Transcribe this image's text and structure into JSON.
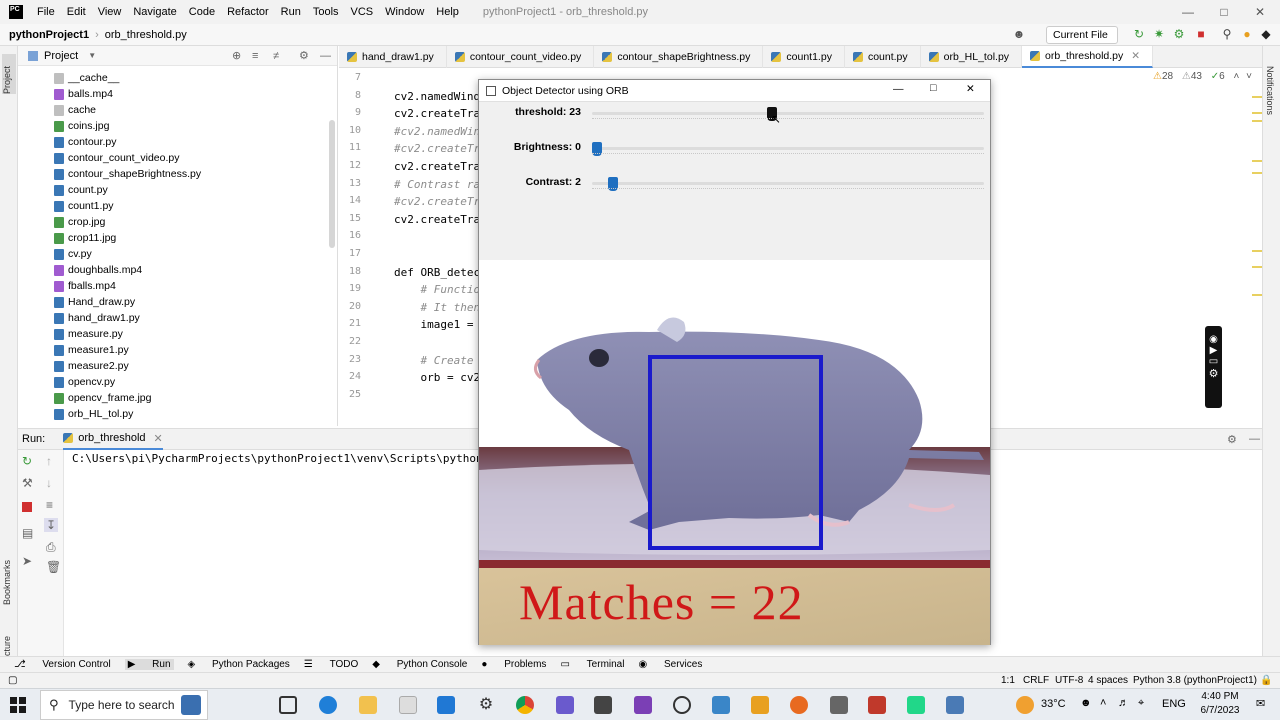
{
  "menu": {
    "items": [
      "File",
      "Edit",
      "View",
      "Navigate",
      "Code",
      "Refactor",
      "Run",
      "Tools",
      "VCS",
      "Window",
      "Help"
    ],
    "window_title": "pythonProject1 - orb_threshold.py"
  },
  "navbar": {
    "project": "pythonProject1",
    "file": "orb_threshold.py",
    "run_config": "Current File"
  },
  "project_panel": {
    "title": "Project",
    "strip_label": "Project",
    "files": [
      "__cache__",
      "balls.mp4",
      "cache",
      "coins.jpg",
      "contour.py",
      "contour_count_video.py",
      "contour_shapeBrightness.py",
      "count.py",
      "count1.py",
      "crop.jpg",
      "crop11.jpg",
      "cv.py",
      "doughballs.mp4",
      "fballs.mp4",
      "Hand_draw.py",
      "hand_draw1.py",
      "measure.py",
      "measure1.py",
      "measure2.py",
      "opencv.py",
      "opencv_frame.jpg",
      "orb_HL_tol.py"
    ]
  },
  "tabs": [
    "hand_draw1.py",
    "contour_count_video.py",
    "contour_shapeBrightness.py",
    "count1.py",
    "count.py",
    "orb_HL_tol.py",
    "orb_threshold.py"
  ],
  "editor": {
    "warnings": {
      "warn": "28",
      "weak": "43",
      "ok": "6"
    },
    "lines": [
      {
        "n": "7",
        "text": ""
      },
      {
        "n": "8",
        "text": "cv2.namedWind"
      },
      {
        "n": "9",
        "text": "cv2.createTra"
      },
      {
        "n": "10",
        "text": "#cv2.namedWin"
      },
      {
        "n": "11",
        "text": "#cv2.createTr"
      },
      {
        "n": "12",
        "text": "cv2.createTra"
      },
      {
        "n": "13",
        "text": "# Contrast ra"
      },
      {
        "n": "14",
        "text": "#cv2.createTr"
      },
      {
        "n": "15",
        "text": "cv2.createTra"
      },
      {
        "n": "16",
        "text": ""
      },
      {
        "n": "17",
        "text": ""
      },
      {
        "n": "18",
        "text": "def ORB_detec"
      },
      {
        "n": "19",
        "text": "    # Functio"
      },
      {
        "n": "20",
        "text": "    # It then"
      },
      {
        "n": "21",
        "text": "    image1 = "
      },
      {
        "n": "22",
        "text": ""
      },
      {
        "n": "23",
        "text": "    # Create "
      },
      {
        "n": "24",
        "text": "    orb = cv2"
      },
      {
        "n": "25",
        "text": ""
      }
    ]
  },
  "run_panel": {
    "label": "Run:",
    "tab": "orb_threshold",
    "console_line": "C:\\Users\\pi\\PycharmProjects\\pythonProject1\\venv\\Scripts\\python."
  },
  "side_labels": {
    "bookmarks": "Bookmarks",
    "structure": "Structure",
    "notifications": "Notifications"
  },
  "bottom_tools": [
    "Version Control",
    "Run",
    "Python Packages",
    "TODO",
    "Python Console",
    "Problems",
    "Terminal",
    "Services"
  ],
  "status": {
    "position": "1:1",
    "line_sep": "CRLF",
    "encoding": "UTF-8",
    "indent": "4 spaces",
    "interpreter": "Python 3.8 (pythonProject1)"
  },
  "cv_window": {
    "title": "Object Detector using ORB",
    "trackbars": [
      {
        "label": "threshold: 23",
        "value": 23,
        "fraction": 0.46
      },
      {
        "label": "Brightness: 0",
        "value": 0,
        "fraction": 0.0
      },
      {
        "label": "Contrast: 2",
        "value": 2,
        "fraction": 0.04
      }
    ],
    "result_text": "Matches = 22",
    "box_color": "#1a1acc"
  },
  "taskbar": {
    "search_placeholder": "Type here to search",
    "weather": "33°C",
    "language": "ENG",
    "time": "4:40 PM",
    "date": "6/7/2023"
  },
  "colors": {
    "accent": "#4a8ad8",
    "text_red": "#d01818",
    "thumb_blue": "#1f6fc0"
  }
}
